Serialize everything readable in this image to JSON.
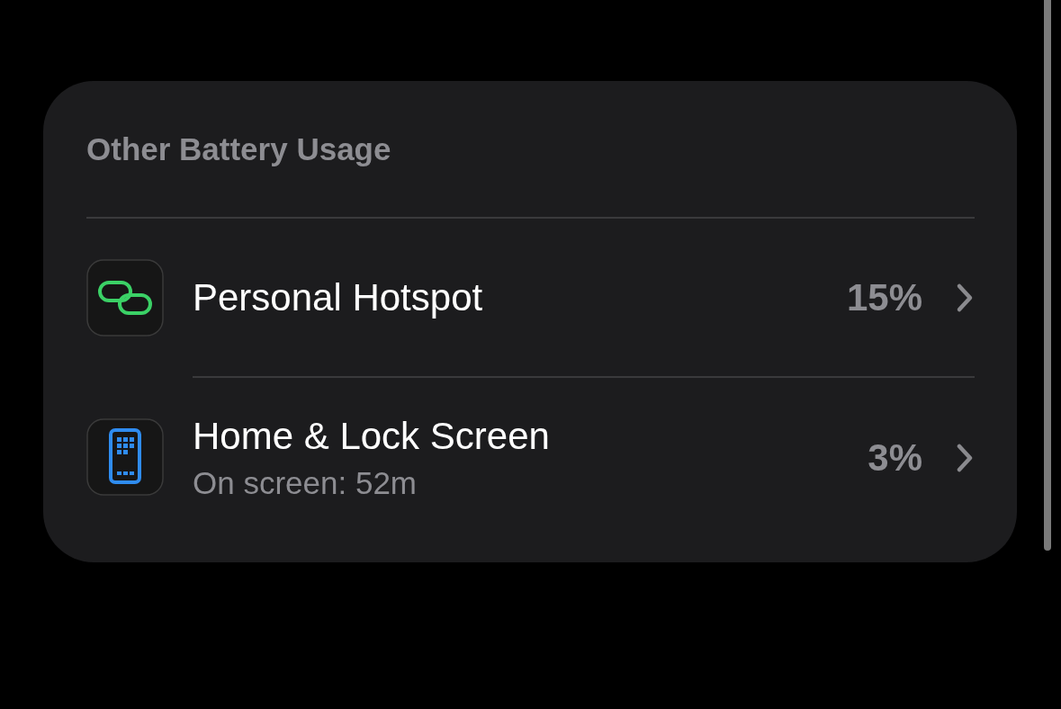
{
  "section": {
    "title": "Other Battery Usage",
    "rows": [
      {
        "kind": "link",
        "label": "Personal Hotspot",
        "value": "15%"
      },
      {
        "kind": "phone",
        "label": "Home & Lock Screen",
        "subtitle": "On screen: 52m",
        "value": "3%"
      }
    ]
  }
}
